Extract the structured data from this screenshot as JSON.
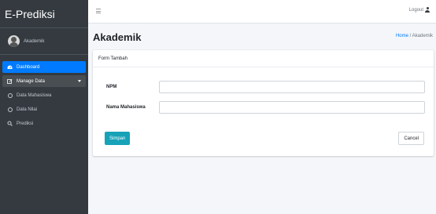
{
  "brand": {
    "name": "E-Prediksi"
  },
  "user": {
    "name": "Akademik"
  },
  "sidebar": {
    "items": [
      {
        "label": "Dashboard",
        "icon": "dashboard-icon",
        "state": "active"
      },
      {
        "label": "Manage Data",
        "icon": "edit-icon",
        "state": "open"
      },
      {
        "label": "Data Mahasiswa",
        "icon": "circle-icon",
        "state": "normal"
      },
      {
        "label": "Data Nilai",
        "icon": "circle-icon",
        "state": "normal"
      },
      {
        "label": "Prediksi",
        "icon": "search-icon",
        "state": "normal"
      }
    ]
  },
  "topbar": {
    "menu_icon": "hamburger-icon",
    "logout_label": "Logout",
    "logout_icon": "user-icon"
  },
  "header": {
    "title": "Akademik",
    "breadcrumb": {
      "home": "Home",
      "separator": "/",
      "current": "Akademik"
    }
  },
  "form": {
    "title": "Form Tambah",
    "fields": [
      {
        "label": "NPM",
        "value": "",
        "placeholder": ""
      },
      {
        "label": "Nama Mahasiswa",
        "value": "",
        "placeholder": ""
      }
    ],
    "save_label": "Simpan",
    "cancel_label": "Cancel"
  },
  "colors": {
    "sidebar_bg": "#343a40",
    "active_item": "#007bff",
    "save_button": "#17a2b8",
    "link": "#007bff",
    "page_bg": "#f4f6f9"
  }
}
